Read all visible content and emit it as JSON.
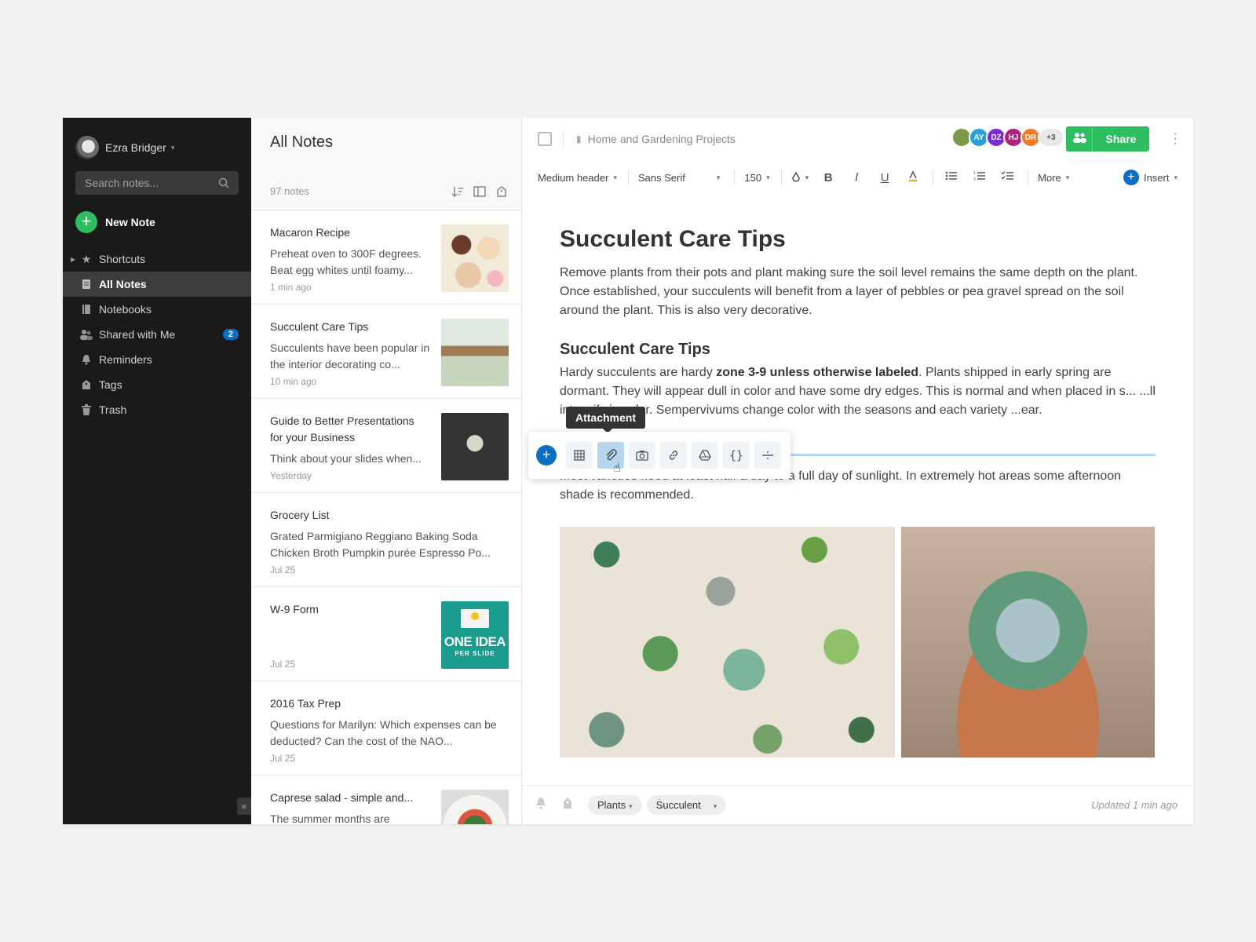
{
  "sidebar": {
    "user_name": "Ezra Bridger",
    "search_placeholder": "Search notes...",
    "new_note_label": "New Note",
    "items": [
      {
        "label": "Shortcuts"
      },
      {
        "label": "All Notes"
      },
      {
        "label": "Notebooks"
      },
      {
        "label": "Shared with Me",
        "badge": "2"
      },
      {
        "label": "Reminders"
      },
      {
        "label": "Tags"
      },
      {
        "label": "Trash"
      }
    ]
  },
  "notelist": {
    "title": "All Notes",
    "count": "97 notes",
    "notes": [
      {
        "title": "Macaron Recipe",
        "snippet": "Preheat oven to 300F degrees. Beat egg whites until foamy...",
        "date": "1 min ago"
      },
      {
        "title": "Succulent Care Tips",
        "snippet": "Succulents have been popular in the interior decorating co...",
        "date": "10 min ago"
      },
      {
        "title": "Guide to Better Presentations for your Business",
        "snippet": "Think about your slides when...",
        "date": "Yesterday"
      },
      {
        "title": "Grocery List",
        "snippet": "Grated Parmigiano Reggiano Baking Soda Chicken Broth Pumpkin purée Espresso Po...",
        "date": "Jul 25"
      },
      {
        "title": "W-9 Form",
        "snippet": "",
        "date": "Jul 25",
        "thumb_text": [
          "ONE IDEA",
          "PER SLIDE"
        ]
      },
      {
        "title": "2016 Tax Prep",
        "snippet": "Questions for Marilyn: Which expenses can be deducted? Can the cost of the NAO...",
        "date": "Jul 25"
      },
      {
        "title": "Caprese salad - simple and...",
        "snippet": "The summer months are",
        "date": ""
      }
    ]
  },
  "editor": {
    "notebook": "Home and Gardening Projects",
    "collaborators": [
      {
        "initials": "",
        "color": "#7a9a4a"
      },
      {
        "initials": "AY",
        "color": "#2a9fd8"
      },
      {
        "initials": "DZ",
        "color": "#7a2ed0"
      },
      {
        "initials": "HJ",
        "color": "#b0207e"
      },
      {
        "initials": "DR",
        "color": "#f07b2b"
      }
    ],
    "more_collaborators": "+3",
    "share_label": "Share",
    "toolbar": {
      "style": "Medium header",
      "font": "Sans Serif",
      "size": "150",
      "bold": "B",
      "italic": "I",
      "underline": "U",
      "more": "More",
      "insert": "Insert"
    },
    "title": "Succulent Care Tips",
    "para1": "Remove plants from their pots and plant making sure the soil level remains the same depth on the plant. Once established, your succulents will benefit from a layer of pebbles or pea gravel spread on the soil around the plant. This is also very decorative.",
    "h2": "Succulent Care Tips",
    "para2_before": "Hardy succulents are hardy ",
    "para2_bold": "zone 3-9 unless otherwise labeled",
    "para2_after": ". Plants shipped in early spring are dormant. They will appear dull in color and have some dry edges. This is normal and when placed in s... ...ll intensify in color. Sempervivums change color with the seasons and each variety ...ear.",
    "para3": "Most varieties need at least half a day to a full day of sunlight. In extremely hot areas some afternoon shade is recommended.",
    "tooltip": "Attachment",
    "tags": [
      "Plants",
      "Succulent"
    ],
    "updated": "Updated 1 min ago"
  }
}
